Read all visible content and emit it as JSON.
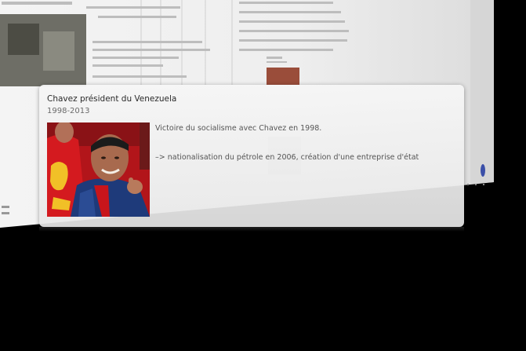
{
  "card": {
    "title": "Chavez président du Venezuela",
    "subtitle": "1998-2013",
    "lines": [
      "Victoire du socialisme avec Chavez en 1998.",
      "–> nationalisation du pétrole en 2006, création d'une entreprise d'état"
    ],
    "photo_icon": "portrait-photo"
  },
  "colors": {
    "background": "#000000",
    "card": "#f2f2f2",
    "title_text": "#2a2a2a",
    "subtitle_text": "#6a6a6a",
    "body_text": "#555555",
    "photo_shirt": "#c8151b"
  }
}
